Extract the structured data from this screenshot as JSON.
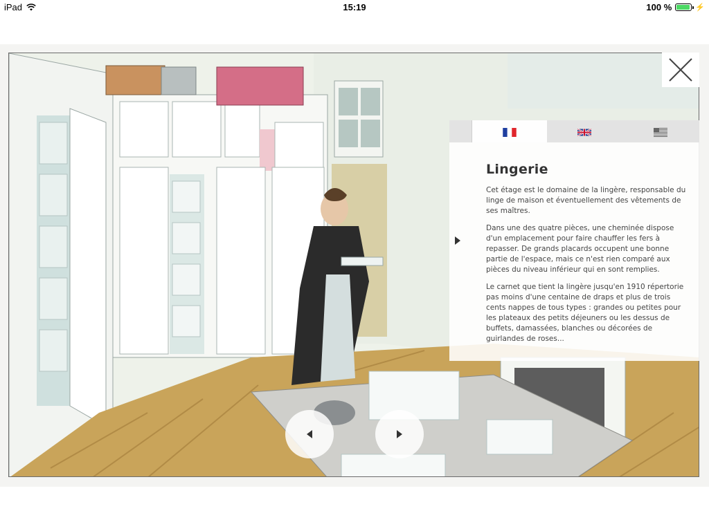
{
  "status_bar": {
    "device": "iPad",
    "time": "15:19",
    "battery_percent": "100 %"
  },
  "icons": {
    "wifi": "wifi-icon",
    "battery": "battery-icon",
    "close": "close-icon",
    "collapse": "chevron-right-icon",
    "prev": "chevron-left-icon",
    "next": "chevron-right-icon",
    "flag_fr": "flag-france-icon",
    "flag_en": "flag-uk-icon",
    "flag_us": "flag-usa-icon"
  },
  "colors": {
    "battery_fill": "#4cd964",
    "tab_inactive": "#e3e3e3",
    "title": "#333333",
    "body": "#444444"
  },
  "info_panel": {
    "active_tab": "fr",
    "title": "Lingerie",
    "paragraphs": [
      "Cet étage est le domaine de la lingère, responsable du linge de maison et éventuellement des vêtements de ses maîtres.",
      "Dans une des quatre pièces, une cheminée dispose d'un emplacement pour faire chauffer les fers à repasser. De grands placards occupent une bonne partie de l'espace, mais ce n'est rien comparé aux pièces du niveau inférieur qui en sont remplies.",
      "Le carnet que tient la lingère jusqu'en 1910 répertorie pas moins d'une centaine de draps et plus de trois cents nappes de tous types : grandes ou petites pour les plateaux des petits déjeuners ou les dessus de buffets, damassées, blanches ou décorées de guirlandes de roses..."
    ]
  }
}
